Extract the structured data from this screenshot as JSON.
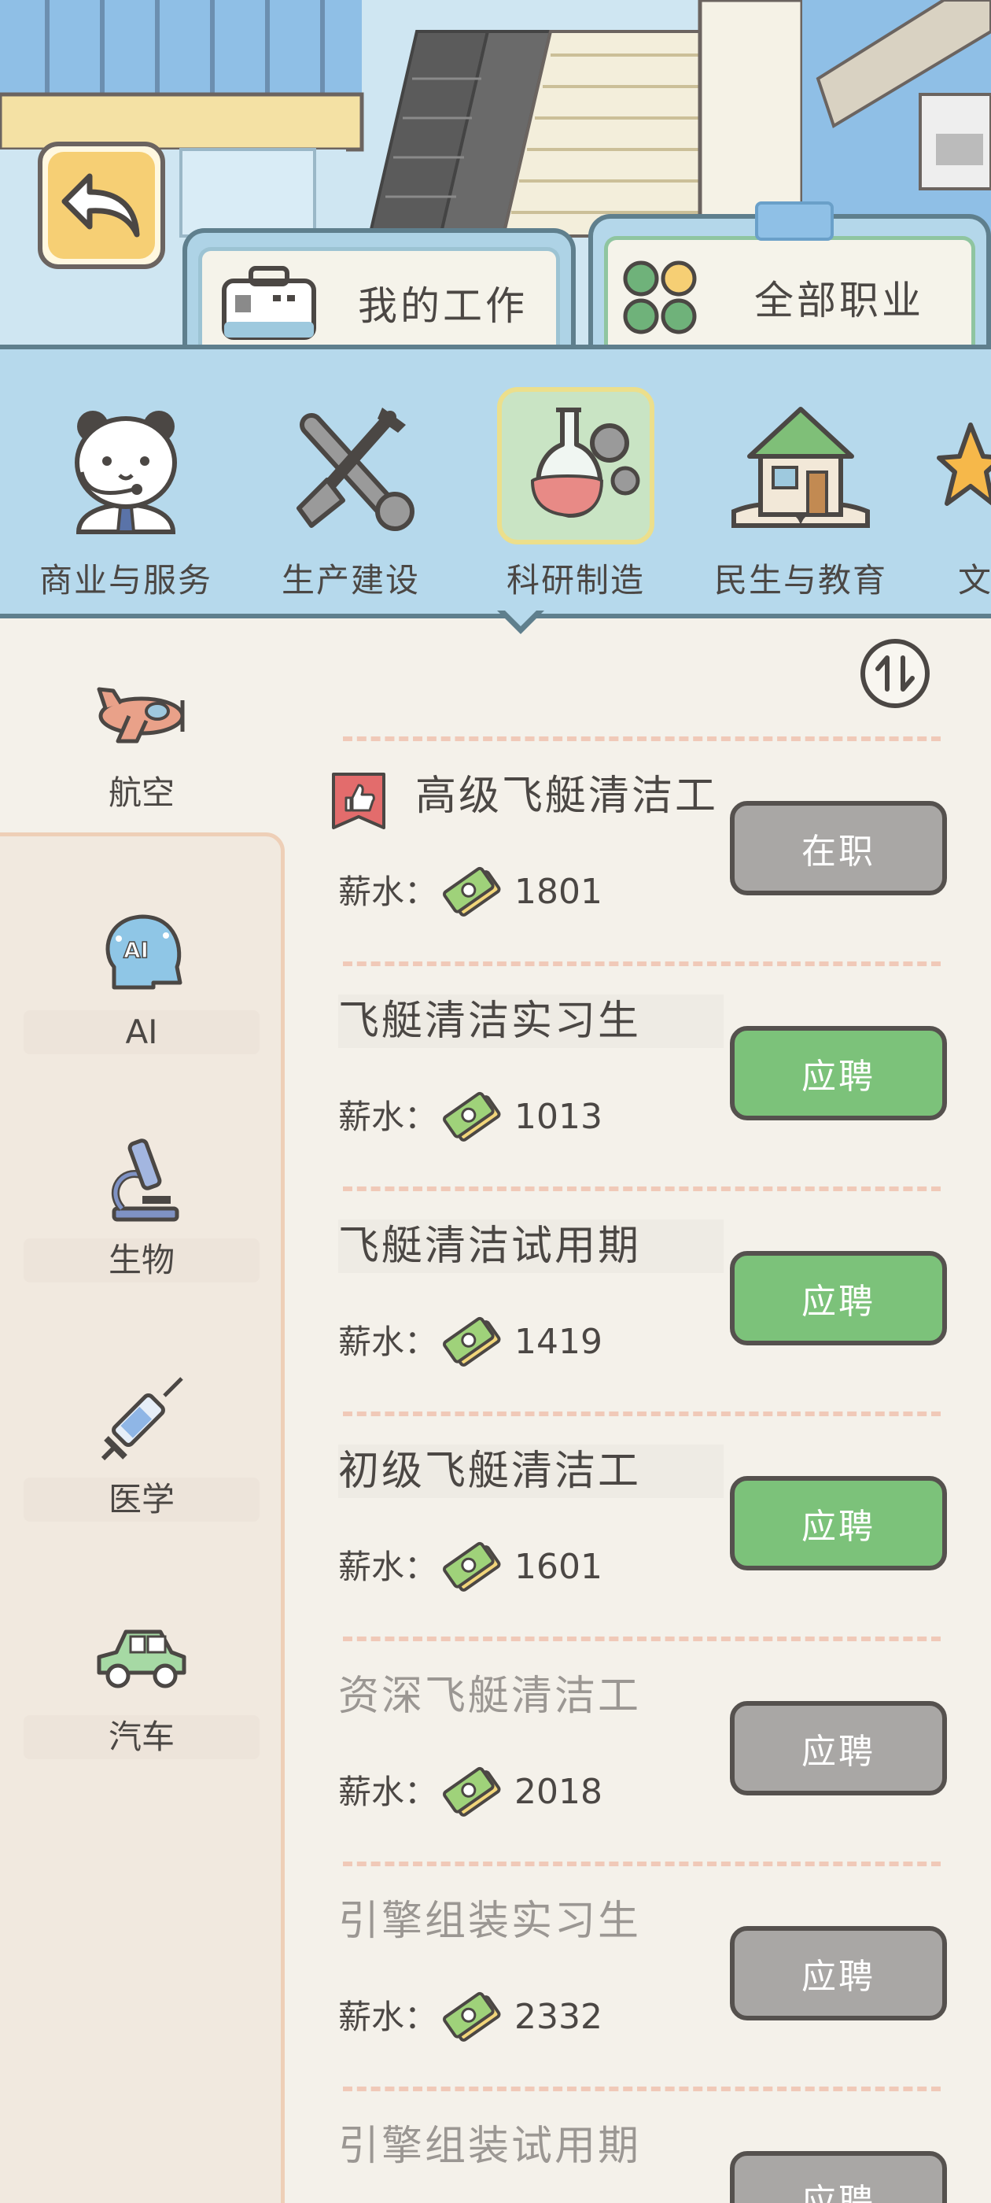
{
  "tabs": [
    {
      "label": "我的工作",
      "icon": "toolbox-icon"
    },
    {
      "label": "全部职业",
      "icon": "grid-icon"
    }
  ],
  "categories": [
    {
      "label": "商业与服务",
      "icon": "panda-operator-icon",
      "selected": false
    },
    {
      "label": "生产建设",
      "icon": "wrench-shovel-icon",
      "selected": false
    },
    {
      "label": "科研制造",
      "icon": "flask-gear-icon",
      "selected": true
    },
    {
      "label": "民生与教育",
      "icon": "house-book-icon",
      "selected": false
    },
    {
      "label": "文",
      "icon": "star-icon",
      "selected": false
    }
  ],
  "sidebar": {
    "items": [
      {
        "label": "航空",
        "icon": "airplane-icon",
        "selected": true
      },
      {
        "label": "AI",
        "icon": "ai-head-icon",
        "selected": false
      },
      {
        "label": "生物",
        "icon": "microscope-icon",
        "selected": false
      },
      {
        "label": "医学",
        "icon": "syringe-icon",
        "selected": false
      },
      {
        "label": "汽车",
        "icon": "car-icon",
        "selected": false
      }
    ]
  },
  "salary_label": "薪水：",
  "jobs": [
    {
      "title": "高级飞艇清洁工",
      "salary": "1801",
      "button": "在职",
      "button_state": "current",
      "recommended": true,
      "available": true
    },
    {
      "title": "飞艇清洁实习生",
      "salary": "1013",
      "button": "应聘",
      "button_state": "apply",
      "recommended": false,
      "available": true
    },
    {
      "title": "飞艇清洁试用期",
      "salary": "1419",
      "button": "应聘",
      "button_state": "apply",
      "recommended": false,
      "available": true
    },
    {
      "title": "初级飞艇清洁工",
      "salary": "1601",
      "button": "应聘",
      "button_state": "apply",
      "recommended": false,
      "available": true
    },
    {
      "title": "资深飞艇清洁工",
      "salary": "2018",
      "button": "应聘",
      "button_state": "locked",
      "recommended": false,
      "available": false
    },
    {
      "title": "引擎组装实习生",
      "salary": "2332",
      "button": "应聘",
      "button_state": "locked",
      "recommended": false,
      "available": false
    },
    {
      "title": "引擎组装试用期",
      "salary": "",
      "button": "应聘",
      "button_state": "locked",
      "recommended": false,
      "available": false
    }
  ],
  "colors": {
    "apply_green": "#7cc27a",
    "locked_gray": "#a9a7a5",
    "category_bar": "#b6d9ec",
    "divider": "#f0c9b8"
  }
}
